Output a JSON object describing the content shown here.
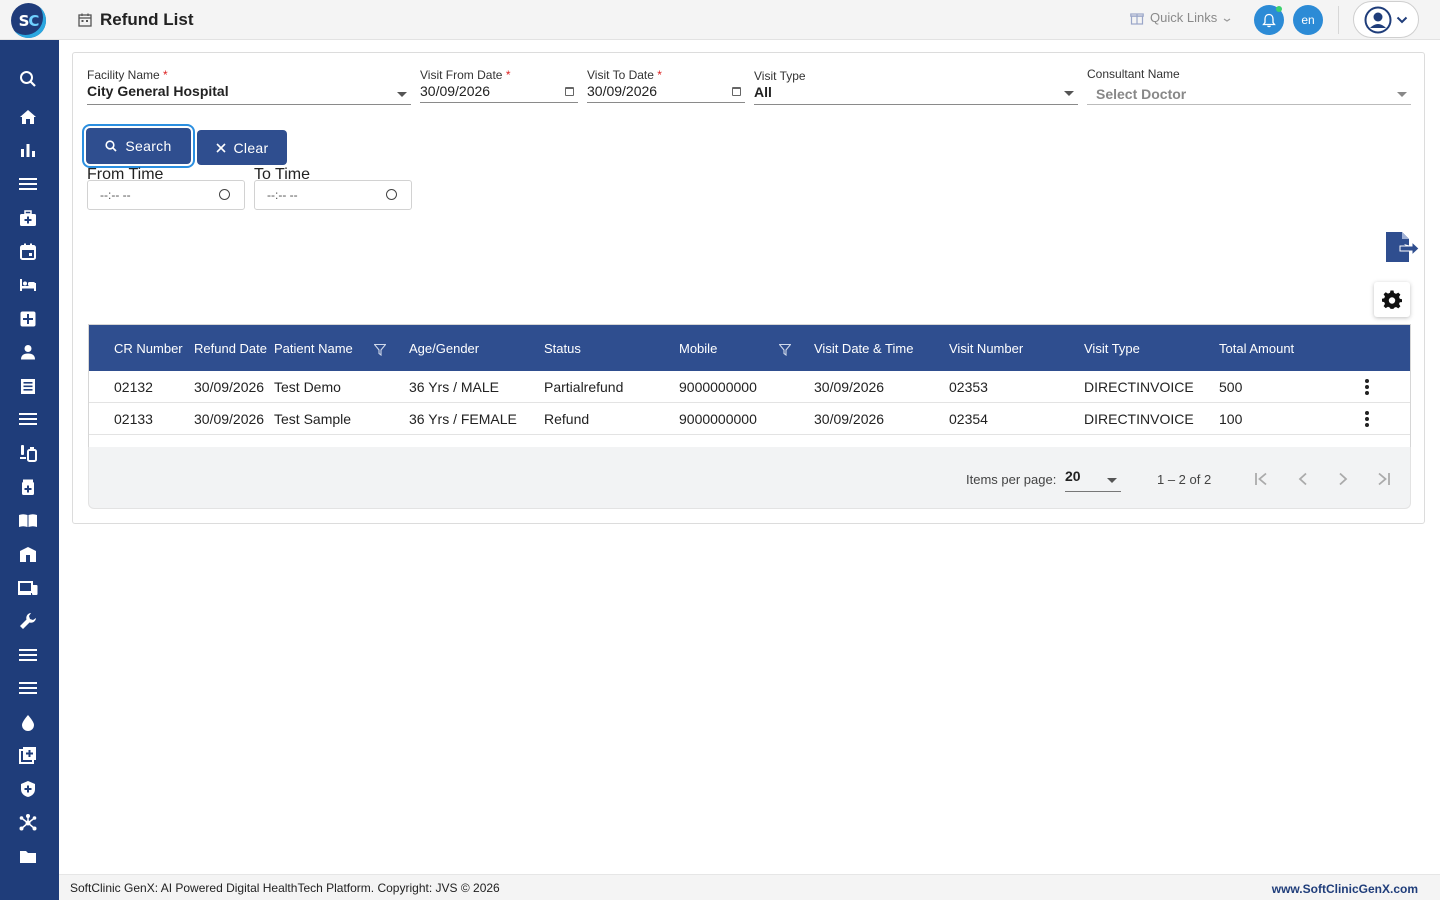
{
  "header": {
    "logo_s": "S",
    "logo_c": "C",
    "page_title": "Refund List",
    "quick_links": "Quick Links",
    "language": "en"
  },
  "sidebar": {
    "icons": [
      "search-icon",
      "home-icon",
      "bar-chart-icon",
      "menu-icon",
      "medical-bag-icon",
      "calendar-icon",
      "bed-icon",
      "hospital-plus-icon",
      "person-icon",
      "receipt-icon",
      "menu-icon-2",
      "lab-icon",
      "pharmacy-icon",
      "book-icon",
      "building-icon",
      "devices-icon",
      "wrench-icon",
      "menu-icon-3",
      "menu-icon-4",
      "blood-drop-icon",
      "add-box-icon",
      "shield-icon",
      "network-icon",
      "folder-icon"
    ]
  },
  "filters": {
    "facility": {
      "label": "Facility Name",
      "required": "*",
      "value": "City General Hospital"
    },
    "visit_from": {
      "label": "Visit From Date",
      "required": "*",
      "value": "30/09/2026"
    },
    "visit_to": {
      "label": "Visit To Date",
      "required": "*",
      "value": "30/09/2026"
    },
    "visit_type": {
      "label": "Visit Type",
      "value": "All"
    },
    "consultant": {
      "label": "Consultant Name",
      "placeholder": "Select Doctor"
    },
    "search_label": "Search",
    "clear_label": "Clear",
    "from_time": {
      "label": "From Time",
      "placeholder": "--:-- --"
    },
    "to_time": {
      "label": "To Time",
      "placeholder": "--:-- --"
    }
  },
  "table": {
    "columns": [
      "CR Number",
      "Refund Date",
      "Patient Name",
      "Age/Gender",
      "Status",
      "Mobile",
      "Visit Date & Time",
      "Visit Number",
      "Visit Type",
      "Total Amount"
    ],
    "rows": [
      [
        "02132",
        "30/09/2026",
        "Test Demo",
        "36 Yrs / MALE",
        "Partialrefund",
        "9000000000",
        "30/09/2026",
        "02353",
        "DIRECTINVOICE",
        "500"
      ],
      [
        "02133",
        "30/09/2026",
        "Test Sample",
        "36 Yrs / FEMALE",
        "Refund",
        "9000000000",
        "30/09/2026",
        "02354",
        "DIRECTINVOICE",
        "100"
      ]
    ]
  },
  "paginator": {
    "items_per_page_label": "Items per page:",
    "items_per_page": "20",
    "range": "1 – 2 of 2"
  },
  "footer": {
    "copyright": "SoftClinic GenX: AI Powered Digital HealthTech Platform. Copyright: JVS © 2026",
    "website": "www.SoftClinicGenX.com"
  },
  "colors": {
    "primary": "#2f4e8f",
    "sidebar": "#1f3d7a",
    "accent": "#2c8bd6"
  }
}
